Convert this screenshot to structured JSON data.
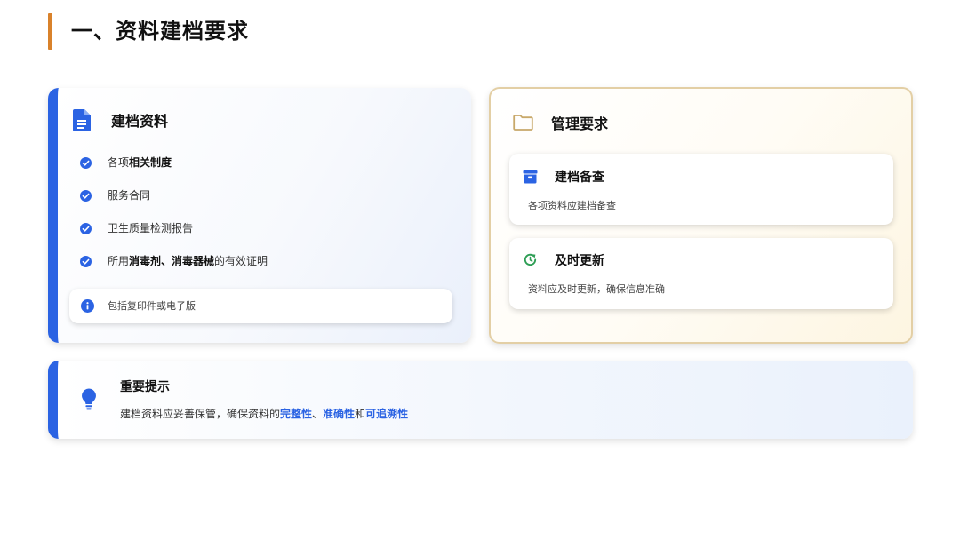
{
  "page": {
    "title": "一、资料建档要求"
  },
  "colors": {
    "accent_blue": "#2b63e3",
    "accent_orange": "#d9822b",
    "gold_border": "#e3cfa5",
    "green": "#2e9e55"
  },
  "archive_card": {
    "icon": "document-icon",
    "title": "建档资料",
    "items": [
      {
        "prefix": "各项",
        "bold": "相关制度",
        "suffix": ""
      },
      {
        "prefix": "服务合同",
        "bold": "",
        "suffix": ""
      },
      {
        "prefix": "卫生质量检测报告",
        "bold": "",
        "suffix": ""
      },
      {
        "prefix": "所用",
        "bold": "消毒剂、消毒器械",
        "suffix": "的有效证明"
      }
    ],
    "note": {
      "icon": "info-icon",
      "text": "包括复印件或电子版"
    }
  },
  "management_card": {
    "icon": "folder-icon",
    "title": "管理要求",
    "items": [
      {
        "icon": "archive-box-icon",
        "title": "建档备查",
        "desc": "各项资料应建档备查"
      },
      {
        "icon": "refresh-icon",
        "title": "及时更新",
        "desc": "资料应及时更新，确保信息准确"
      }
    ]
  },
  "tip_card": {
    "icon": "lightbulb-icon",
    "title": "重要提示",
    "text_prefix": "建档资料应妥善保管，确保资料的",
    "highlight_1": "完整性",
    "sep_1": "、",
    "highlight_2": "准确性",
    "sep_2": "和",
    "highlight_3": "可追溯性"
  }
}
